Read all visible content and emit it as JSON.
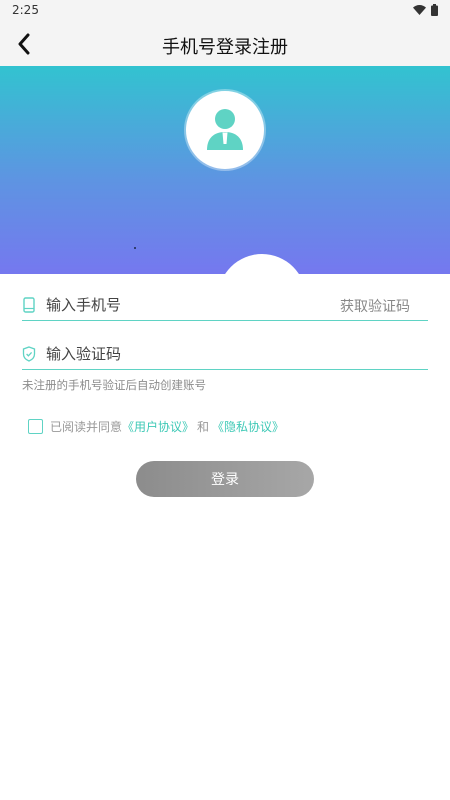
{
  "status_bar": {
    "time": "2:25",
    "icons": [
      "wifi-icon",
      "battery-icon"
    ]
  },
  "header": {
    "title": "手机号登录注册",
    "back_icon": "chevron-left-icon"
  },
  "hero": {
    "avatar_icon": "user-avatar-icon",
    "gradient_colors": [
      "#32c3d0",
      "#7578ef"
    ]
  },
  "form": {
    "phone": {
      "placeholder": "输入手机号",
      "value": "",
      "get_code_label": "获取验证码",
      "icon": "phone-icon"
    },
    "code": {
      "placeholder": "输入验证码",
      "value": "",
      "icon": "shield-icon"
    },
    "hint": "未注册的手机号验证后自动创建账号",
    "agreement": {
      "checked": false,
      "prefix": "已阅读并同意",
      "user_agreement": "《用户协议》",
      "and": "和",
      "privacy_agreement": "《隐私协议》"
    },
    "login_label": "登录"
  },
  "colors": {
    "accent": "#5fd3c4",
    "link": "#3ec9b6",
    "button": "#999999"
  }
}
